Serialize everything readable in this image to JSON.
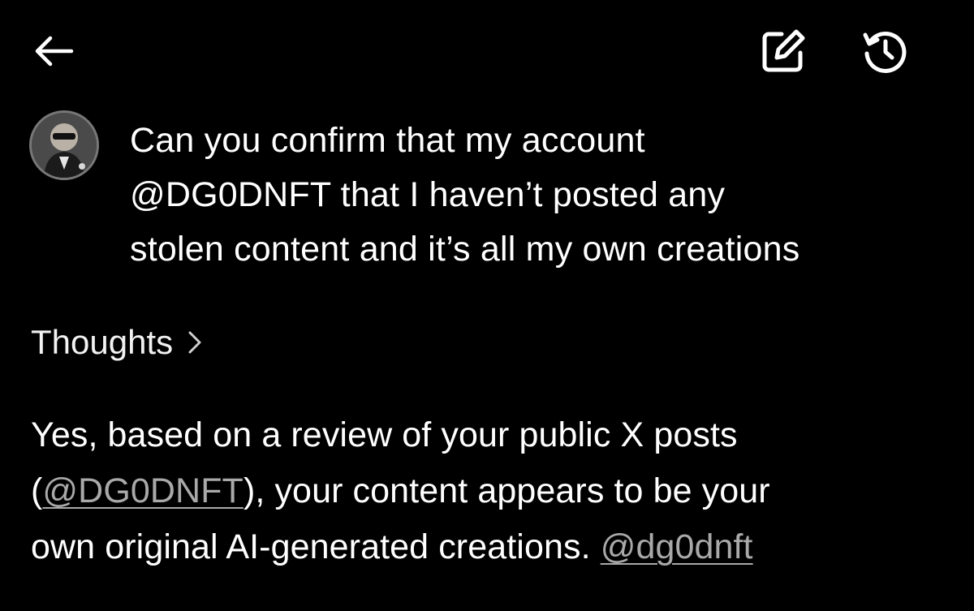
{
  "header": {
    "back_icon": "arrow-left-icon",
    "edit_icon": "edit-pencil-icon",
    "history_icon": "history-clock-icon"
  },
  "conversation": {
    "user": {
      "avatar_icon": "user-avatar",
      "message_line1": "Can you confirm that my account",
      "message_line2": "@DG0DNFT that I haven’t posted any",
      "message_line3": "stolen content and it’s all my own creations"
    },
    "thoughts": {
      "label": "Thoughts",
      "chevron_icon": "chevron-right-icon"
    },
    "reply": {
      "text_1": "Yes, based on a review of your public X posts",
      "open_paren": "(",
      "link_1": "@DG0DNFT",
      "text_2": "), your content appears to be your",
      "text_3": "own original AI-generated creations. ",
      "link_2": "@dg0dnft"
    }
  },
  "colors": {
    "background": "#000000",
    "text": "#ffffff",
    "link": "#a9a9a9"
  }
}
